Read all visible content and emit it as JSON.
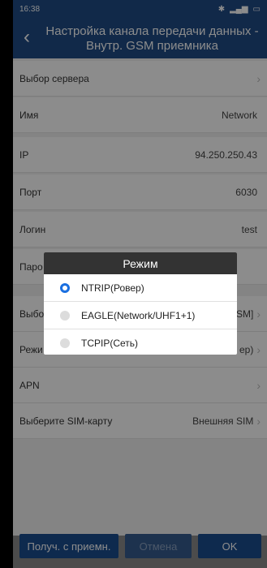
{
  "status": {
    "time": "16:38"
  },
  "header": {
    "back": "‹",
    "title": "Настройка канала передачи данных - Внутр. GSM приемника"
  },
  "rows": [
    {
      "label": "Выбор сервера",
      "value": ""
    },
    {
      "label": "Имя",
      "value": "Network"
    },
    {
      "label": "IP",
      "value": "94.250.250.43"
    },
    {
      "label": "Порт",
      "value": "6030"
    },
    {
      "label": "Логин",
      "value": "test"
    },
    {
      "label": "Паро",
      "value": ""
    },
    {
      "label": "Выбо",
      "value": "SM]"
    },
    {
      "label": "Режи",
      "value": "ер)"
    },
    {
      "label": "APN",
      "value": ""
    },
    {
      "label": "Выберите SIM-карту",
      "value": "Внешняя SIM"
    }
  ],
  "dialog": {
    "title": "Режим",
    "options": [
      {
        "label": "NTRIP(Ровер)",
        "selected": true
      },
      {
        "label": "EAGLE(Network/UHF1+1)",
        "selected": false
      },
      {
        "label": "TCPIP(Сеть)",
        "selected": false
      }
    ]
  },
  "buttons": {
    "receive": "Получ. с приемн.",
    "cancel": "Отмена",
    "ok": "OK"
  }
}
